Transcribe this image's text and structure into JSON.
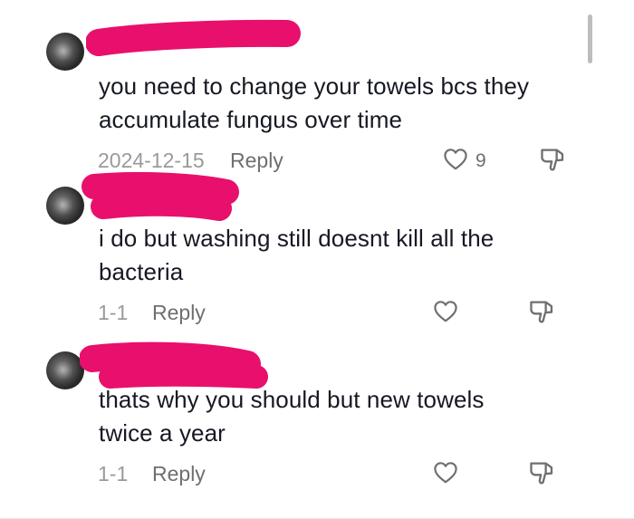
{
  "comments": [
    {
      "text_line1": "you need to change your towels bcs they",
      "text_line2": "accumulate fungus over time",
      "date": "2024-12-15",
      "reply_label": "Reply",
      "likes": "9"
    },
    {
      "text_line1": "i do but washing still doesnt kill all the",
      "text_line2": "bacteria",
      "date": "1-1",
      "reply_label": "Reply",
      "likes": ""
    },
    {
      "text_line1": "thats why you should but new towels",
      "text_line2": "twice a year",
      "date": "1-1",
      "reply_label": "Reply",
      "likes": ""
    }
  ],
  "icons": {
    "like": "heart-outline-icon",
    "dislike": "thumbs-down-icon"
  },
  "colors": {
    "redaction": "#e8106c",
    "text": "#161823",
    "meta": "#9a9a9a",
    "icon": "#6f6f6f"
  }
}
